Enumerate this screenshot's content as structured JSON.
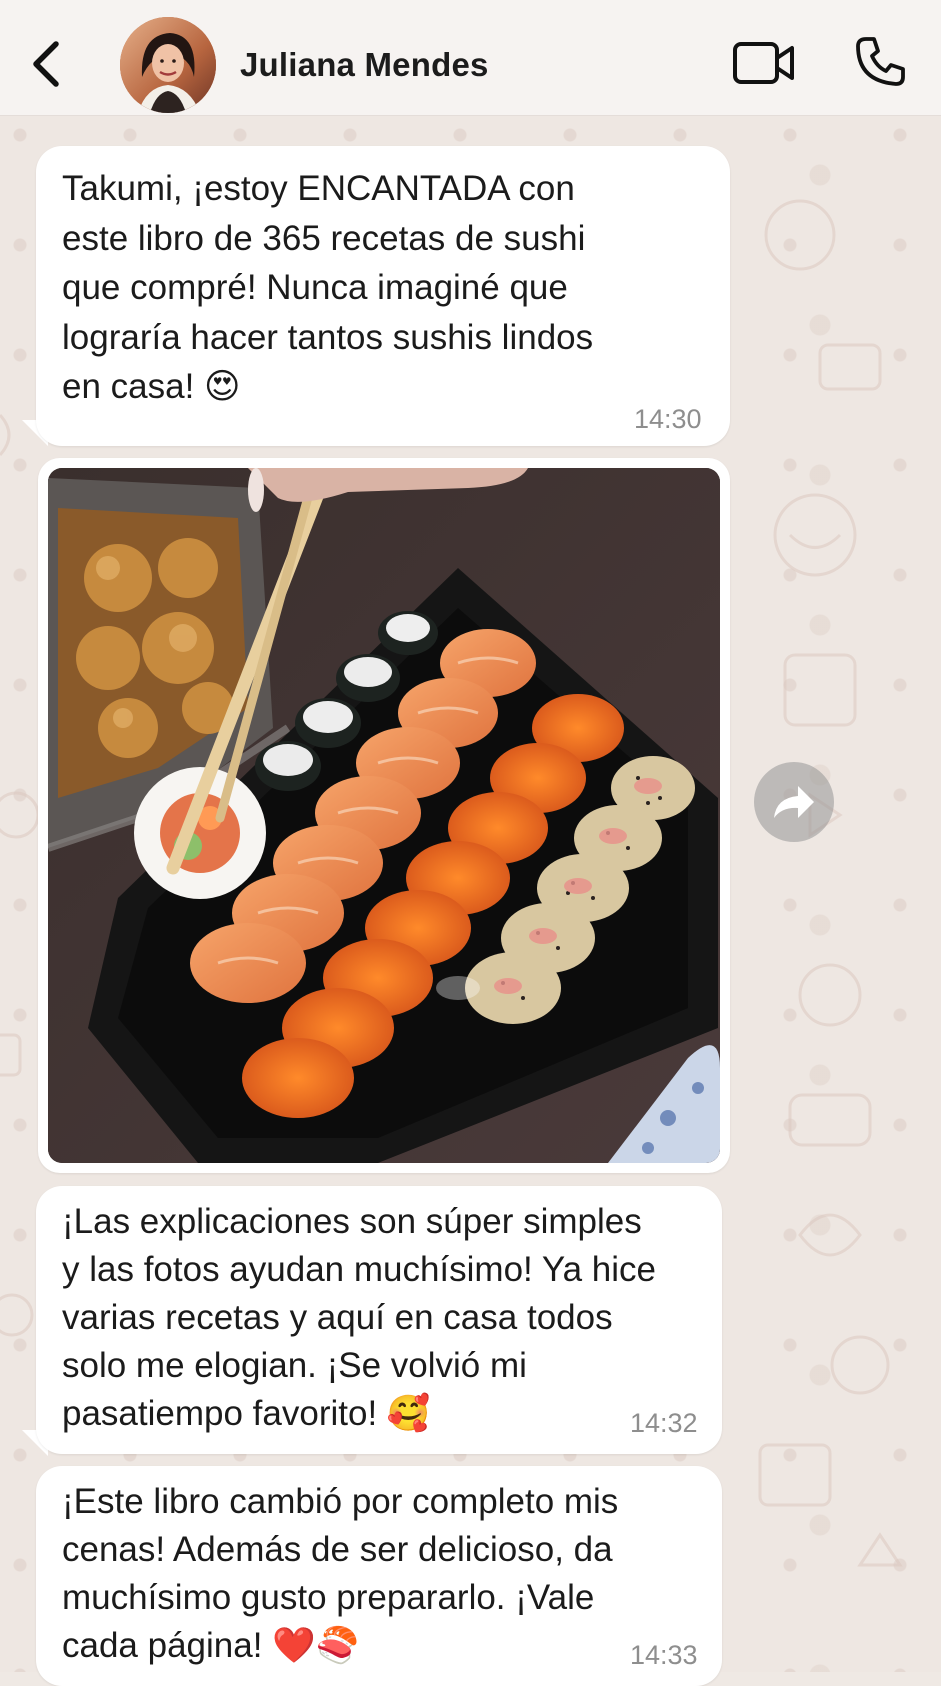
{
  "header": {
    "contact_name": "Juliana Mendes",
    "back_icon": "chevron-left-icon",
    "video_icon": "video-camera-icon",
    "call_icon": "phone-icon"
  },
  "messages": [
    {
      "type": "text",
      "text": "Takumi, ¡estoy ENCANTADA con\neste libro de 365 recetas de sushi\nque compré! Nunca imaginé que\nlograría hacer tantos sushis lindos\nen casa! 😍",
      "time": "14:30"
    },
    {
      "type": "image",
      "image_description_icon": "sushi-photo"
    },
    {
      "type": "text",
      "text": "¡Las explicaciones son súper simples\ny las fotos ayudan muchísimo! Ya hice\nvarias recetas y aquí en casa todos\nsolo me elogian. ¡Se volvió mi\npasatiempo favorito! 🥰",
      "time": "14:32"
    },
    {
      "type": "text",
      "text": "¡Este libro cambió por completo mis\ncenas! Además de ser delicioso, da\nmuchísimo gusto prepararlo. ¡Vale\ncada página! ❤️🍣",
      "time": "14:33"
    }
  ],
  "colors": {
    "header_bg": "#f6f3f1",
    "wallpaper": "#eee7e2",
    "bubble": "#ffffff",
    "time_text": "#8e8e8e"
  }
}
